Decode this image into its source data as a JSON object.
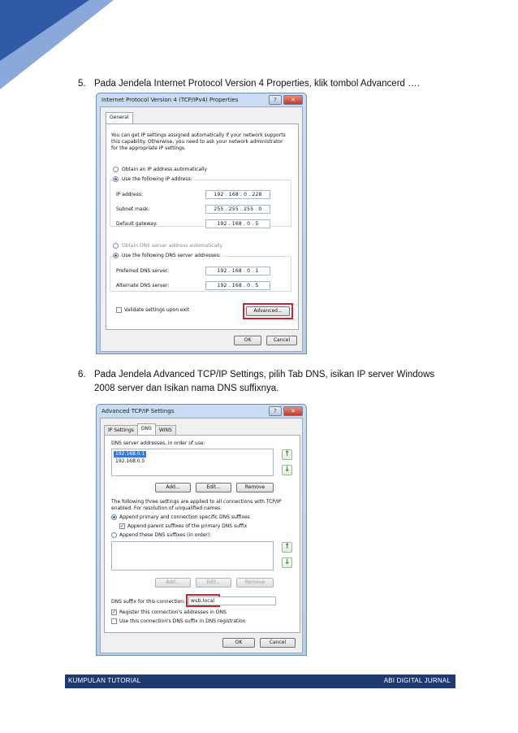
{
  "colors": {
    "corner_dark": "#2f5aa8",
    "corner_light": "#8aa8da",
    "footer": "#1f3a6e",
    "highlight": "#d0202a"
  },
  "step5": {
    "num": "5.",
    "text": "Pada Jendela Internet Protocol Version 4 Properties, klik tombol Advancerd …."
  },
  "step6": {
    "num": "6.",
    "text": "Pada Jendela Advanced TCP/IP Settings, pilih Tab DNS, isikan IP server Windows 2008 server dan Isikan nama DNS suffixnya."
  },
  "ipv4": {
    "title": "Internet Protocol Version 4 (TCP/IPv4) Properties",
    "help": "?",
    "close": "✕",
    "tab": "General",
    "desc1": "You can get IP settings assigned automatically if your network supports",
    "desc2": "this capability. Otherwise, you need to ask your network administrator",
    "desc3": "for the appropriate IP settings.",
    "auto_ip": "Obtain an IP address automatically",
    "use_ip": "Use the following IP address:",
    "ip_label": "IP address:",
    "ip_value": "192 . 168 .  0  . 228",
    "mask_label": "Subnet mask:",
    "mask_value": "255 . 255 . 255 .  0",
    "gw_label": "Default gateway:",
    "gw_value": "192 . 168 .  0  .  5",
    "auto_dns": "Obtain DNS server address automatically",
    "use_dns": "Use the following DNS server addresses:",
    "pref_label": "Preferred DNS server:",
    "pref_value": "192 . 168 .  0  .  1",
    "alt_label": "Alternate DNS server:",
    "alt_value": "192 . 168 .  0  .  5",
    "validate": "Validate settings upon exit",
    "advanced": "Advanced...",
    "ok": "OK",
    "cancel": "Cancel"
  },
  "adv": {
    "title": "Advanced TCP/IP Settings",
    "help": "?",
    "close": "✕",
    "tab_ip": "IP Settings",
    "tab_dns": "DNS",
    "tab_wins": "WINS",
    "dns_list_label": "DNS server addresses, in order of use:",
    "dns_list": [
      "192.168.0.1",
      "192.168.0.5"
    ],
    "add": "Add...",
    "edit": "Edit...",
    "remove": "Remove",
    "info1": "The following three settings are applied to all connections with TCP/IP",
    "info2": "enabled. For resolution of unqualified names:",
    "append_primary": "Append primary and connection specific DNS suffixes",
    "append_parent": "Append parent suffixes of the primary DNS suffix",
    "append_these": "Append these DNS suffixes (in order):",
    "suffix_label": "DNS suffix for this connection:",
    "suffix_value": "wsb.local",
    "register": "Register this connection's addresses in DNS",
    "use_suffix": "Use this connection's DNS suffix in DNS registration",
    "ok": "OK",
    "cancel": "Cancel"
  },
  "footer": {
    "left": "KUMPULAN TUTORIAL",
    "right": "ABI DIGITAL JURNAL"
  }
}
